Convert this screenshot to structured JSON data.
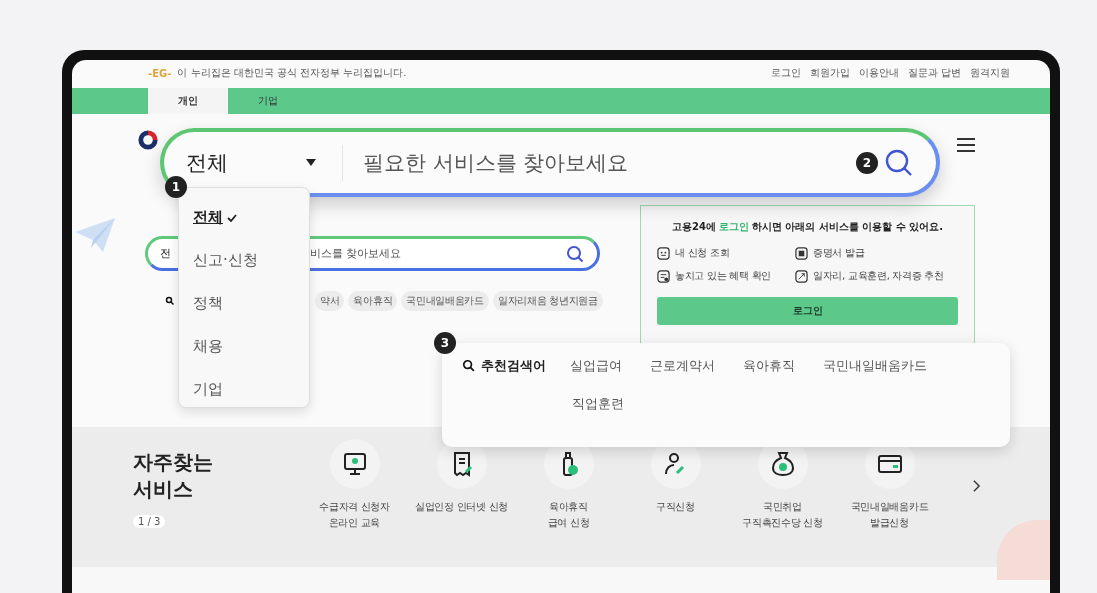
{
  "notice": {
    "logo": "-EG-",
    "text": "이 누리집은 대한민국 공식 전자정부 누리집입니다."
  },
  "utility_links": [
    "로그인",
    "회원가입",
    "이용안내",
    "질문과 답변",
    "원격지원"
  ],
  "tabs": [
    {
      "label": "개인",
      "selected": true
    },
    {
      "label": "기업",
      "selected": false
    }
  ],
  "search": {
    "category": "전",
    "placeholder": "비스를 찾아보세요"
  },
  "keywords": [
    "약서",
    "육아휴직",
    "국민내일배움카드",
    "일자리채움 청년지원금"
  ],
  "login_panel": {
    "title_before": "고용24에",
    "title_link": "로그인",
    "title_after": "하시면 아래의 서비스를 이용할 수 있어요.",
    "items": [
      {
        "kind": "list",
        "label": "내 신청 조회"
      },
      {
        "kind": "certificate",
        "label": "증명서 발급"
      },
      {
        "kind": "benefit",
        "label": "놓치고 있는 혜택 확인"
      },
      {
        "kind": "recommend",
        "label": "일자리, 교육훈련, 자격증 추천"
      }
    ],
    "button": "로그인"
  },
  "services": {
    "title": "자주찾는 서비스",
    "pager": "1 / 3",
    "items": [
      {
        "kind": "monitor",
        "lines": [
          "수급자격 신청자",
          "온라인 교육"
        ]
      },
      {
        "kind": "document",
        "lines": [
          "실업인정 인터넷 신청"
        ]
      },
      {
        "kind": "bottle",
        "lines": [
          "육아휴직",
          "급여 신청"
        ]
      },
      {
        "kind": "person",
        "lines": [
          "구직신청"
        ]
      },
      {
        "kind": "moneybag",
        "lines": [
          "국민취업",
          "구직촉진수당 신청"
        ]
      },
      {
        "kind": "card",
        "lines": [
          "국민내일배움카드",
          "발급신청"
        ]
      }
    ]
  },
  "zoom_search": {
    "category": "전체",
    "placeholder": "필요한 서비스를 찾아보세요",
    "badge": "2"
  },
  "category_menu": {
    "badge": "1",
    "items": [
      {
        "label": "전체",
        "selected": true
      },
      {
        "label": "신고·신청",
        "selected": false
      },
      {
        "label": "정책",
        "selected": false
      },
      {
        "label": "채용",
        "selected": false
      },
      {
        "label": "기업",
        "selected": false
      }
    ]
  },
  "recommended": {
    "badge": "3",
    "title": "추천검색어",
    "keywords": [
      "실업급여",
      "근로계약서",
      "육아휴직",
      "국민내일배움카드",
      "직업훈련"
    ]
  }
}
